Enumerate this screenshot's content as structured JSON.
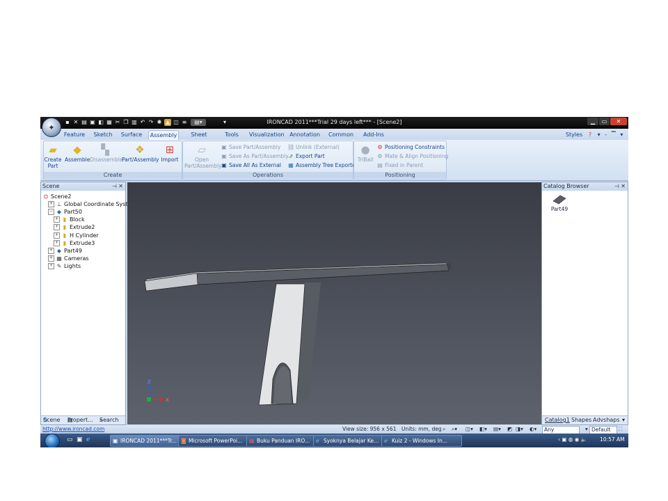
{
  "window": {
    "title": "IRONCAD 2011***Trial 29 days left*** - [Scene2]"
  },
  "ribbon_tabs": [
    {
      "label": "Feature"
    },
    {
      "label": "Sketch"
    },
    {
      "label": "Surface"
    },
    {
      "label": "Assembly",
      "active": true
    },
    {
      "label": "Sheet Metal"
    },
    {
      "label": "Tools"
    },
    {
      "label": "Visualization"
    },
    {
      "label": "Annotation"
    },
    {
      "label": "Common"
    },
    {
      "label": "Add-Ins"
    }
  ],
  "styles_label": "Styles",
  "create_group": {
    "label": "Create",
    "buttons": {
      "create_part": {
        "line1": "Create",
        "line2": "Part"
      },
      "assemble": "Assemble",
      "disassemble": "Disassemble",
      "part_assembly": "Part/Assembly",
      "import": "Import"
    }
  },
  "operations_group": {
    "label": "Operations",
    "open": {
      "line1": "Open",
      "line2": "Part/Assembly"
    },
    "save_part_assembly": "Save Part/Assembly",
    "save_as_part_assembly": "Save As Part/Assembly...",
    "save_all_external": "Save All As External",
    "unlink_external": "Unlink (External)",
    "export_part": "Export Part",
    "assembly_tree_exporter": "Assembly Tree Exporter"
  },
  "positioning_group": {
    "label": "Positioning",
    "triball": "TriBall",
    "positioning_constraints": "Positioning Constraints",
    "mate_align": "Mate & Align Positioning",
    "fixed_in_parent": "Fixed in Parent"
  },
  "scene_panel": {
    "title": "Scene",
    "tree": [
      {
        "label": "Scene2",
        "icon": "scene-icon",
        "level": 0
      },
      {
        "label": "Global Coordinate System",
        "icon": "axis-icon",
        "level": 1
      },
      {
        "label": "Part50",
        "icon": "part-icon",
        "level": 1
      },
      {
        "label": "Block",
        "icon": "feature-icon",
        "level": 2
      },
      {
        "label": "Extrude2",
        "icon": "feature-icon",
        "level": 2
      },
      {
        "label": "H Cylinder",
        "icon": "feature-icon",
        "level": 2
      },
      {
        "label": "Extrude3",
        "icon": "feature-icon",
        "level": 2
      },
      {
        "label": "Part49",
        "icon": "part-icon",
        "level": 1
      },
      {
        "label": "Cameras",
        "icon": "camera-icon",
        "level": 1
      },
      {
        "label": "Lights",
        "icon": "light-icon",
        "level": 1
      }
    ],
    "footer_tabs": [
      "Scene",
      "Propert...",
      "Search"
    ]
  },
  "catalog_panel": {
    "title": "Catalog Browser",
    "item": "Part49",
    "footer_tabs": [
      "Catalog1",
      "Shapes",
      "Advshaps"
    ]
  },
  "status_bar": {
    "url": "http://www.ironcad.com",
    "view_size": "View size: 956 x 561",
    "units": "Units: mm, deg",
    "filter": "Any",
    "style": "Default"
  },
  "taskbar": {
    "items": [
      "IRONCAD 2011***Tr...",
      "Microsoft PowerPoi...",
      "Buku Panduan IRO...",
      "Syoknya Belajar Ke...",
      "Kuiz 2 - Windows In..."
    ],
    "clock": "10:57 AM"
  },
  "axis_labels": {
    "z": "Z",
    "x": "X"
  },
  "colors": {
    "viewport_top": "#393c44",
    "viewport_bottom": "#5e626c",
    "ribbon_text": "#15428b",
    "titlebar": "#0c0c0c"
  }
}
